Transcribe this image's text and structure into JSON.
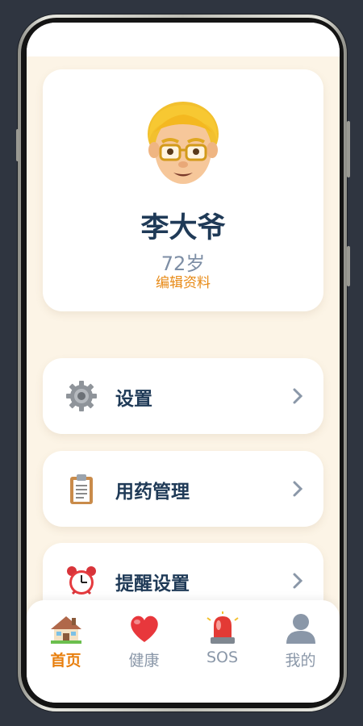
{
  "profile": {
    "name": "李大爷",
    "age": "72岁",
    "edit_label": "编辑资料",
    "avatar_icon": "elderly-man-avatar-icon"
  },
  "menu": {
    "items": [
      {
        "label": "设置",
        "icon": "gear-icon"
      },
      {
        "label": "用药管理",
        "icon": "clipboard-icon"
      },
      {
        "label": "提醒设置",
        "icon": "alarm-clock-icon"
      }
    ]
  },
  "tabbar": {
    "active": "首页",
    "tabs": [
      {
        "label": "首页",
        "icon": "house-icon"
      },
      {
        "label": "健康",
        "icon": "heart-icon"
      },
      {
        "label": "SOS",
        "icon": "siren-icon"
      },
      {
        "label": "我的",
        "icon": "user-silhouette-icon"
      }
    ]
  },
  "colors": {
    "background": "#fcf4e6",
    "primary_text": "#1f3a57",
    "secondary_text": "#7d8ea5",
    "accent": "#e87f0e"
  }
}
